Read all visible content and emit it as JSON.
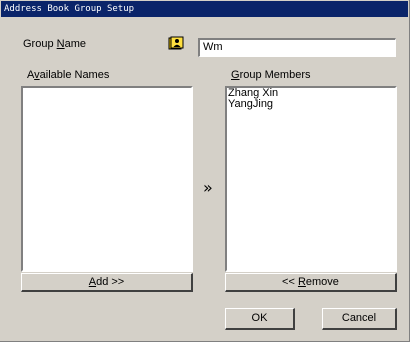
{
  "window": {
    "title": "Address Book Group Setup"
  },
  "group_name": {
    "label_prefix": "Group ",
    "label_accel": "N",
    "label_suffix": "ame",
    "value": "Wm"
  },
  "available": {
    "label_prefix": "A",
    "label_accel": "v",
    "label_suffix": "ailable Names",
    "items": []
  },
  "members": {
    "label_accel": "G",
    "label_suffix": "roup Members",
    "items": [
      "Zhang Xin",
      "YangJing"
    ]
  },
  "buttons": {
    "add": {
      "accel": "A",
      "rest": "dd >>"
    },
    "remove": {
      "prefix": "<< ",
      "accel": "R",
      "rest": "emove"
    },
    "ok": "OK",
    "cancel": "Cancel"
  },
  "icons": {
    "address_book": "address-book-icon",
    "transfer": "double-chevron-right-icon"
  }
}
